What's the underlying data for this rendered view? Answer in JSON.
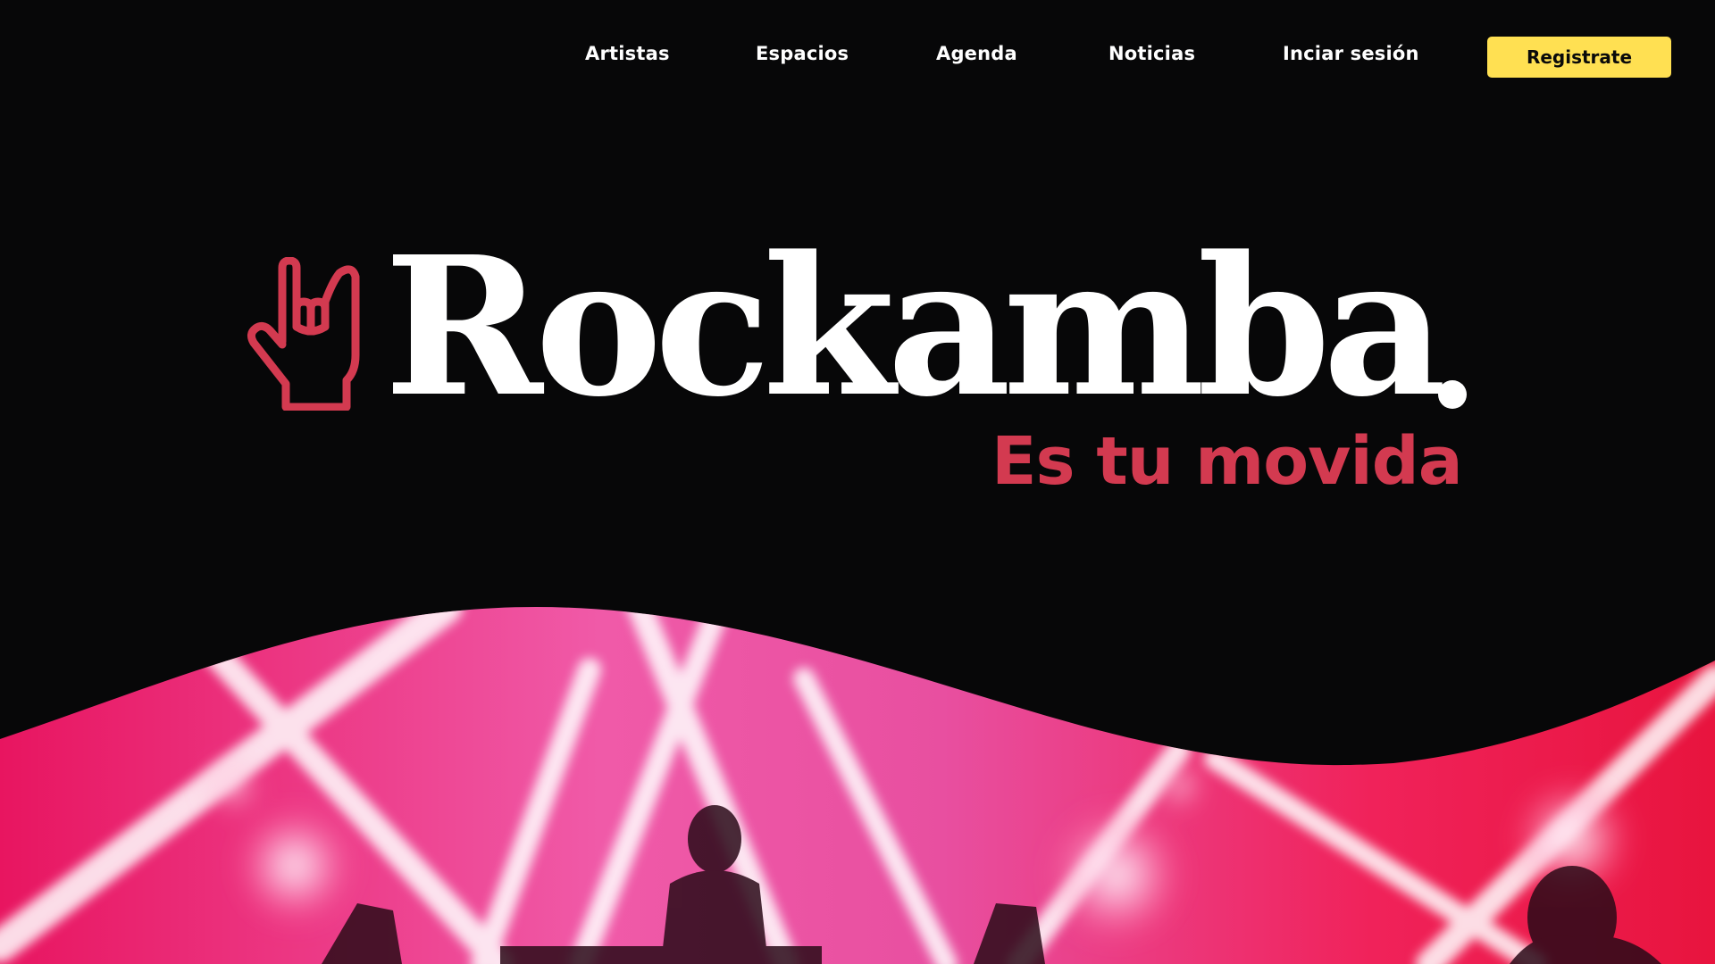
{
  "nav": {
    "links": [
      {
        "label": "Artistas"
      },
      {
        "label": "Espacios"
      },
      {
        "label": "Agenda"
      },
      {
        "label": "Noticias"
      },
      {
        "label": "Inciar sesión"
      }
    ],
    "cta_label": "Registrate"
  },
  "brand": {
    "name": "Rockamba",
    "tagline": "Es tu movida",
    "logo_icon": "rock-hand-icon"
  },
  "hero": {
    "image": "concert-stage-lights-photo"
  },
  "colors": {
    "background": "#070708",
    "accent_red": "#D33A50",
    "cta_yellow": "#FFE052",
    "text": "#ffffff"
  }
}
